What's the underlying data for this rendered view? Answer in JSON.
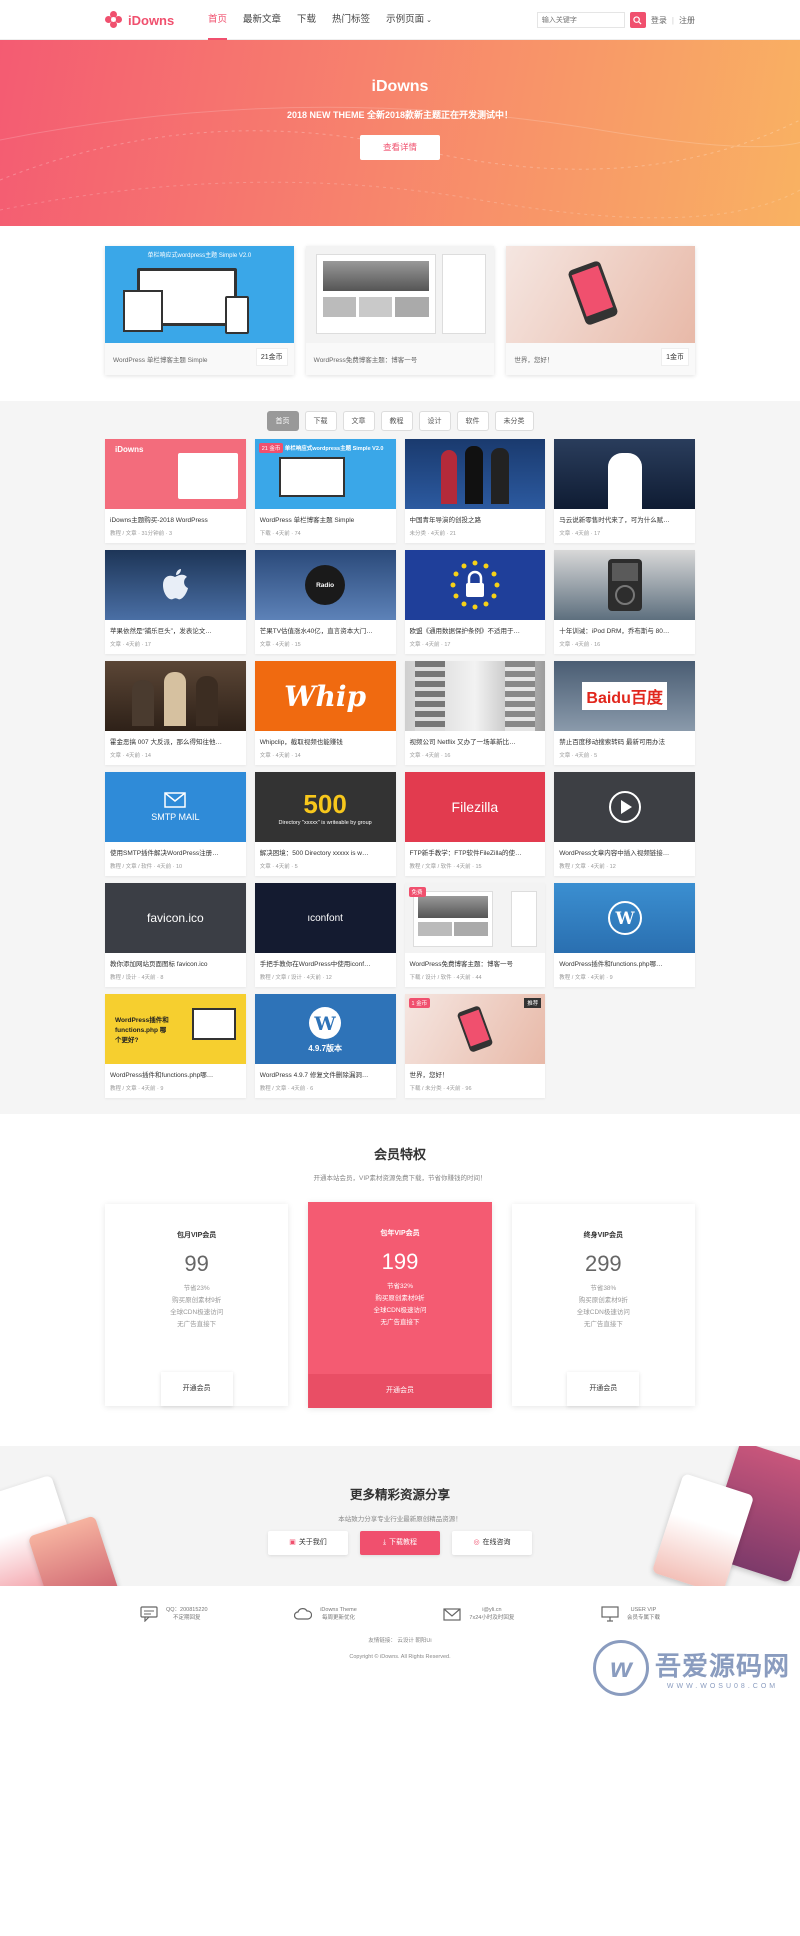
{
  "header": {
    "logo_text": "iDowns",
    "nav": [
      "首页",
      "最新文章",
      "下载",
      "热门标签",
      "示例页面"
    ],
    "search_placeholder": "输入关键字",
    "login": "登录",
    "register": "注册",
    "sep": "|"
  },
  "hero": {
    "title": "iDowns",
    "subtitle": "2018 NEW THEME 全新2018款新主题正在开发测试中！",
    "button": "查看详情"
  },
  "featured": [
    {
      "caption": "WordPress 单栏博客主题 Simple",
      "price": "21金币",
      "thumb_text": "单栏响应式wordpress主题 Simple V2.0"
    },
    {
      "caption": "WordPress免费博客主题：博客一号",
      "price": ""
    },
    {
      "caption": "世界，您好！",
      "price": "1金币"
    }
  ],
  "posts": {
    "tabs": [
      "首页",
      "下载",
      "文章",
      "教程",
      "设计",
      "软件",
      "未分类"
    ],
    "items": [
      {
        "title": "iDowns主题购买-2018 WordPress",
        "info": "教程 / 文章 · 31分钟前 · 3",
        "img_text": "iDowns"
      },
      {
        "title": "WordPress 单栏博客主题 Simple",
        "info": "下载 · 4天前 · 74",
        "badge": "21 金币",
        "img_text": "单栏响应式wordpress主题 Simple V2.0"
      },
      {
        "title": "中国青年导演的创投之路",
        "info": "未分类 · 4天前 · 21"
      },
      {
        "title": "马云说新零售时代来了，可为什么赋…",
        "info": "文章 · 4天前 · 17"
      },
      {
        "title": "苹果依然是“捕乐巨头”，发表论文…",
        "info": "文章 · 4天前 · 17"
      },
      {
        "title": "芒果TV估值涨水40亿，直言资本大门…",
        "info": "文章 · 4天前 · 15",
        "img_text": "Radio"
      },
      {
        "title": "欧盟《通用数据保护条例》不适用于…",
        "info": "文章 · 4天前 · 17"
      },
      {
        "title": "十年训诫：iPod DRM，乔布斯与 80…",
        "info": "文章 · 4天前 · 16"
      },
      {
        "title": "霍金恶搞 007 大反派，那么得知往他…",
        "info": "文章 · 4天前 · 14"
      },
      {
        "title": "Whipclip，截取视频也能赚钱",
        "info": "文章 · 4天前 · 14",
        "img_text": "Whip"
      },
      {
        "title": "视频公司 Netflix 又办了一场革新比…",
        "info": "文章 · 4天前 · 16"
      },
      {
        "title": "禁止百度移动搜索转码 最新可用办法",
        "info": "文章 · 4天前 · 5",
        "img_text": "Baidu百度"
      },
      {
        "title": "使用SMTP插件解决WordPress注册…",
        "info": "教程 / 文章 / 软件 · 4天前 · 10",
        "img_text": "SMTP MAIL"
      },
      {
        "title": "解决困境：500 Directory xxxxx is w…",
        "info": "文章 · 4天前 · 5",
        "img_text": "500",
        "img_sub": "Directory \"xxxxx\" is writeable by group"
      },
      {
        "title": "FTP新手教学：FTP软件FileZilla的使…",
        "info": "教程 / 文章 / 软件 · 4天前 · 15",
        "img_text": "Filezilla"
      },
      {
        "title": "WordPress文章内容中插入视频链接…",
        "info": "教程 / 文章 · 4天前 · 12"
      },
      {
        "title": "教你添加网站页面图标 favicon.ico",
        "info": "教程 / 设计 · 4天前 · 8",
        "img_text": "favicon.ico"
      },
      {
        "title": "手把手教你在WordPress中使用iconf…",
        "info": "教程 / 文章 / 设计 · 4天前 · 12",
        "img_text": "ıconfont"
      },
      {
        "title": "WordPress免费博客主题：博客一号",
        "info": "下载 / 设计 / 软件 · 4天前 · 44",
        "badge": "免费"
      },
      {
        "title": "WordPress插件和functions.php哪…",
        "info": "教程 / 文章 · 4天前 · 9"
      },
      {
        "title": "WordPress插件和functions.php哪…",
        "info": "教程 / 文章 · 4天前 · 9",
        "img_text": "WordPress插件和functions.php 哪个更好?"
      },
      {
        "title": "WordPress 4.9.7 修复文件删除漏洞…",
        "info": "教程 / 文章 · 4天前 · 6",
        "img_text": "4.9.7版本"
      },
      {
        "title": "世界，您好！",
        "info": "下载 / 未分类 · 4天前 · 96",
        "badge": "1 金币",
        "badge2": "推荐"
      }
    ]
  },
  "vip": {
    "title": "会员特权",
    "subtitle": "开通本站会员，VIP素材资源免费下载，节省你赚钱的时间！",
    "plans": [
      {
        "name": "包月VIP会员",
        "price": "99",
        "features": [
          "节省23%",
          "购买原创素材9折",
          "全球CDN极速访问",
          "无广告直接下"
        ],
        "button": "开通会员"
      },
      {
        "name": "包年VIP会员",
        "price": "199",
        "features": [
          "节省32%",
          "购买原创素材9折",
          "全球CDN极速访问",
          "无广告直接下"
        ],
        "button": "开通会员"
      },
      {
        "name": "终身VIP会员",
        "price": "299",
        "features": [
          "节省38%",
          "购买原创素材9折",
          "全球CDN极速访问",
          "无广告直接下"
        ],
        "button": "开通会员"
      }
    ]
  },
  "more": {
    "title": "更多精彩资源分享",
    "subtitle": "本站致力分享专业行业最新原创精品资源！",
    "buttons": [
      "关于我们",
      "下载教程",
      "在线咨询"
    ]
  },
  "footer": {
    "items": [
      {
        "line1": "QQ：200815220",
        "line2": "不定期回复",
        "icon": "chat-icon"
      },
      {
        "line1": "iDowns Theme",
        "line2": "每周更新优化",
        "icon": "cloud-icon"
      },
      {
        "line1": "i@yli.cn",
        "line2": "7x24小时及时回复",
        "icon": "mail-icon"
      },
      {
        "line1": "USER VIP",
        "line2": "会员专属下载",
        "icon": "monitor-icon"
      }
    ],
    "links": "友情链接：   云设计   朝阳Ui",
    "copyright": "Copyright © iDowns. All Rights Reserved.",
    "watermark": "吾爱源码网",
    "watermark_url": "WWW.WOSU08.COM"
  },
  "colors": {
    "accent": "#f0506e",
    "hero_start": "#f45b72",
    "hero_end": "#f9b262"
  }
}
